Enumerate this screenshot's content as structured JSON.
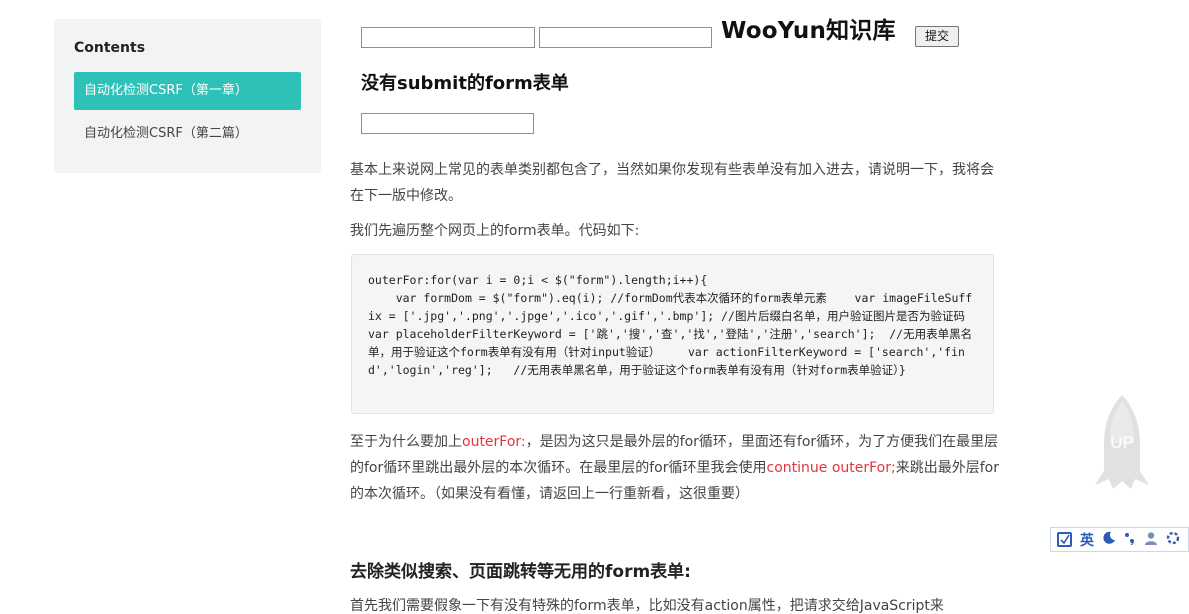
{
  "toc": {
    "title": "Contents",
    "items": [
      {
        "label": "自动化检测CSRF（第一章）",
        "active": true
      },
      {
        "label": "自动化检测CSRF（第二篇）",
        "active": false
      }
    ]
  },
  "demo": {
    "heading": "WooYun知识库",
    "submit_label": "提交",
    "subheading": "没有submit的form表单"
  },
  "article": {
    "p1": "基本上来说网上常见的表单类别都包含了，当然如果你发现有些表单没有加入进去，请说明一下，我将会在下一版中修改。",
    "p2": "我们先遍历整个网页上的form表单。代码如下:",
    "code": "outerFor:for(var i = 0;i < $(\"form\").length;i++){\n    var formDom = $(\"form\").eq(i); //formDom代表本次循环的form表单元素    var imageFileSuffix = ['.jpg','.png','.jpge','.ico','.gif','.bmp']; //图片后缀白名单，用户验证图片是否为验证码    var placeholderFilterKeyword = ['跳','搜','查','找','登陆','注册','search'];  //无用表单黑名单，用于验证这个form表单有没有用（针对input验证）    var actionFilterKeyword = ['search','find','login','reg'];   //无用表单黑名单，用于验证这个form表单有没有用（针对form表单验证）}",
    "p3_part1": "至于为什么要加上",
    "p3_red1": "outerFor:",
    "p3_part2": "，是因为这只是最外层的for循环，里面还有for循环，为了方便我们在最里层的for循环里跳出最外层的本次循环。在最里层的for循环里我会使用",
    "p3_red2": "continue outerFor;",
    "p3_part3": "来跳出最外层for的本次循环。（如果没有看懂，请返回上一行重新看，这很重要）",
    "h3": "去除类似搜索、页面跳转等无用的form表单:",
    "p4": "首先我们需要假象一下有没有特殊的form表单，比如没有action属性，把请求交给JavaScript来"
  },
  "back_to_top": {
    "label": "UP"
  },
  "ime_toolbar": {
    "lang": "英",
    "icons": [
      "checkbox-icon",
      "moon-icon",
      "punctuation-icon",
      "user-icon",
      "settings-icon"
    ]
  },
  "colors": {
    "accent": "#2ec1b8",
    "link_red": "#e0363c"
  }
}
